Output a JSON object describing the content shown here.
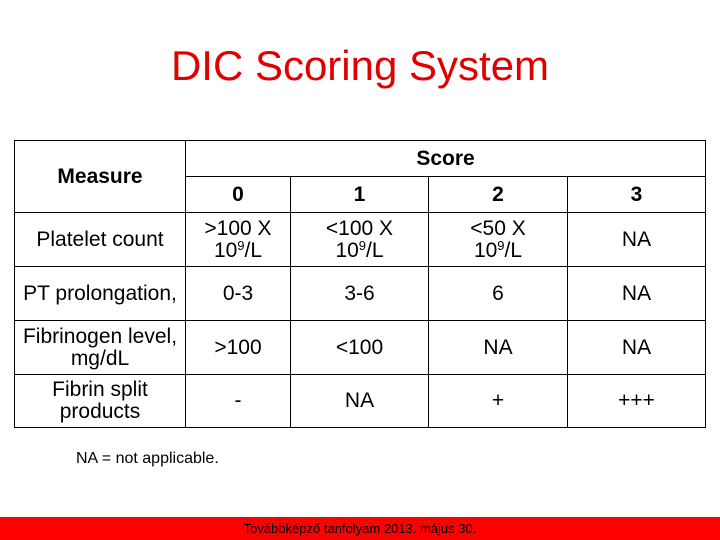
{
  "title": "DIC Scoring System",
  "table": {
    "measure_header": "Measure",
    "score_header": "Score",
    "score_columns": [
      "0",
      "1",
      "2",
      "3"
    ],
    "rows": [
      {
        "measure": "Platelet count",
        "cells": [
          {
            "main": ">100 X",
            "base": "10",
            "sup": "9",
            "unit": "/L"
          },
          {
            "main": "<100 X",
            "base": "10",
            "sup": "9",
            "unit": "/L"
          },
          {
            "main": "<50 X",
            "base": "10",
            "sup": "9",
            "unit": "/L"
          },
          {
            "main": "NA"
          }
        ]
      },
      {
        "measure": "PT prolongation,",
        "cells": [
          {
            "main": "0-3"
          },
          {
            "main": "3-6"
          },
          {
            "main": "6"
          },
          {
            "main": "NA"
          }
        ]
      },
      {
        "measure": "Fibrinogen level, mg/dL",
        "cells": [
          {
            "main": ">100"
          },
          {
            "main": "<100"
          },
          {
            "main": "NA"
          },
          {
            "main": "NA"
          }
        ]
      },
      {
        "measure": "Fibrin split products",
        "cells": [
          {
            "main": "-"
          },
          {
            "main": "NA"
          },
          {
            "main": "+"
          },
          {
            "main": "+++"
          }
        ]
      }
    ]
  },
  "note": "NA = not applicable.",
  "footer": "Továbbképző tanfolyam 2013. május 30.",
  "colors": {
    "title": "#e00000",
    "header": "#e0401a",
    "footer_bg": "#ff0000"
  }
}
